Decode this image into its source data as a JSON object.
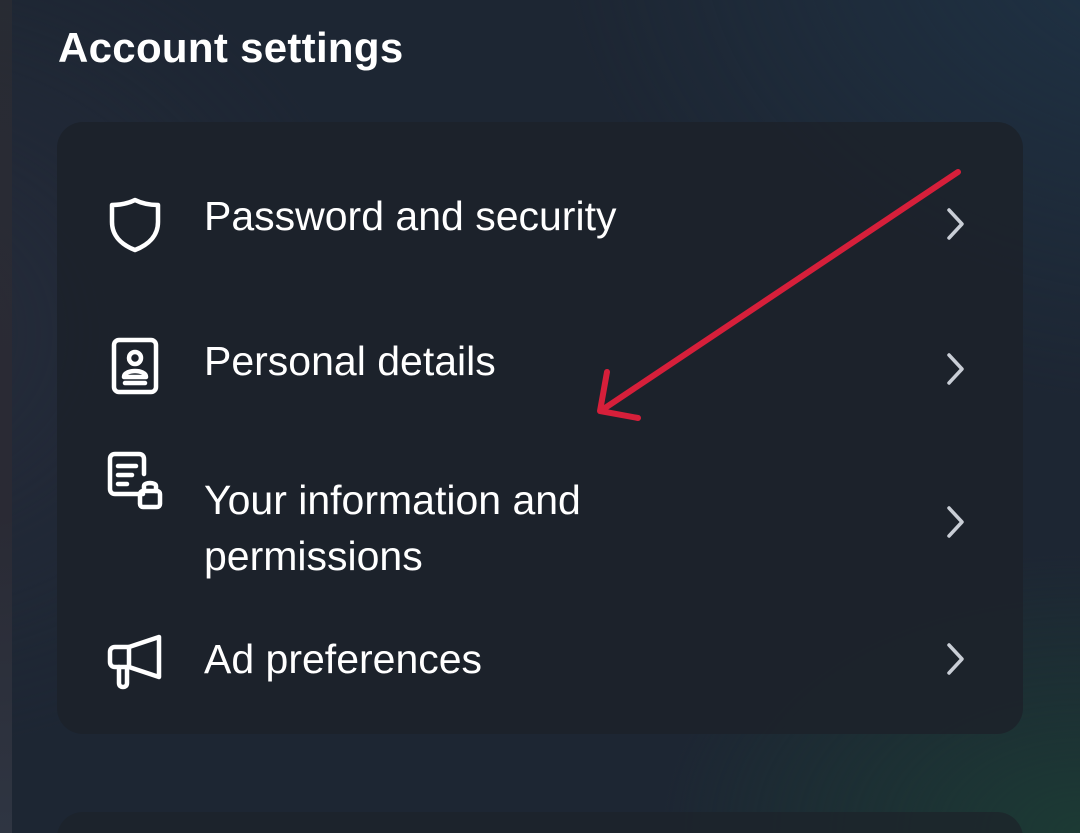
{
  "page": {
    "title": "Account settings"
  },
  "menu": {
    "items": [
      {
        "icon": "shield-icon",
        "label": "Password and security",
        "chevron": "chevron-right-icon"
      },
      {
        "icon": "id-card-icon",
        "label": "Personal details",
        "chevron": "chevron-right-icon"
      },
      {
        "icon": "document-lock-icon",
        "label": "Your information and permissions",
        "chevron": "chevron-right-icon"
      },
      {
        "icon": "megaphone-icon",
        "label": "Ad preferences",
        "chevron": "chevron-right-icon"
      }
    ]
  },
  "annotation": {
    "type": "arrow",
    "color": "#d61f3a",
    "points_to": "Your information and permissions"
  },
  "colors": {
    "text": "#ffffff",
    "card_background": "#1c222a",
    "chevron": "#c9ced6"
  }
}
